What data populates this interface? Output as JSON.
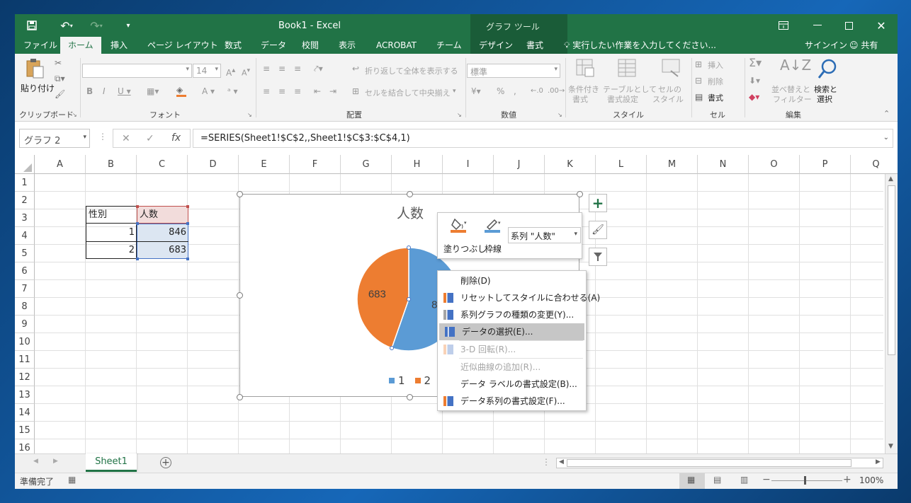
{
  "window": {
    "title": "Book1 - Excel",
    "chart_tools_label": "グラフ ツール"
  },
  "tabs": [
    "ファイル",
    "ホーム",
    "挿入",
    "ページ レイアウト",
    "数式",
    "データ",
    "校閲",
    "表示",
    "ACROBAT",
    "チーム",
    "デザイン",
    "書式"
  ],
  "tell_me": "実行したい作業を入力してください...",
  "signin": "サインイン",
  "share": "共有",
  "ribbon": {
    "clipboard": {
      "paste": "貼り付け",
      "label": "クリップボード"
    },
    "font": {
      "label": "フォント",
      "size": "14"
    },
    "alignment": {
      "wrap": "折り返して全体を表示する",
      "merge": "セルを結合して中央揃え",
      "label": "配置"
    },
    "number": {
      "format": "標準",
      "label": "数値"
    },
    "styles": {
      "conditional_1": "条件付き",
      "conditional_2": "書式",
      "table_1": "テーブルとして",
      "table_2": "書式設定",
      "cell_1": "セルの",
      "cell_2": "スタイル",
      "label": "スタイル"
    },
    "cells": {
      "insert": "挿入",
      "delete": "削除",
      "format": "書式",
      "label": "セル"
    },
    "editing": {
      "sort_1": "並べ替えと",
      "sort_2": "フィルター",
      "find_1": "検索と",
      "find_2": "選択",
      "label": "編集"
    }
  },
  "formula_bar": {
    "name_box": "グラフ 2",
    "formula": "=SERIES(Sheet1!$C$2,,Sheet1!$C$3:$C$4,1)"
  },
  "columns": [
    "A",
    "B",
    "C",
    "D",
    "E",
    "F",
    "G",
    "H",
    "I",
    "J",
    "K",
    "L",
    "M",
    "N",
    "O",
    "P",
    "Q"
  ],
  "rows": [
    "1",
    "2",
    "3",
    "4",
    "5",
    "6",
    "7",
    "8",
    "9",
    "10",
    "11",
    "12",
    "13",
    "14",
    "15",
    "16"
  ],
  "cells": {
    "b2": "性別",
    "c2": "人数",
    "b3": "1",
    "c3": "846",
    "b4": "2",
    "c4": "683"
  },
  "chart_data": {
    "type": "pie",
    "title": "人数",
    "categories": [
      "1",
      "2"
    ],
    "values": [
      846,
      683
    ],
    "data_labels": [
      "846",
      "683"
    ],
    "colors": [
      "#5b9bd5",
      "#ed7d31"
    ],
    "legend": "bottom"
  },
  "mini_toolbar": {
    "fill": "塗りつぶし",
    "outline": "枠線",
    "series": "系列 \"人数\""
  },
  "context_menu": [
    {
      "label": "削除(D)",
      "disabled": false
    },
    {
      "label": "リセットしてスタイルに合わせる(A)",
      "disabled": false
    },
    {
      "label": "系列グラフの種類の変更(Y)...",
      "disabled": false
    },
    {
      "label": "データの選択(E)...",
      "disabled": false,
      "highlighted": true
    },
    {
      "label": "3-D 回転(R)...",
      "disabled": true
    },
    {
      "label": "近似曲線の追加(R)...",
      "disabled": true
    },
    {
      "label": "データ ラベルの書式設定(B)...",
      "disabled": false
    },
    {
      "label": "データ系列の書式設定(F)...",
      "disabled": false
    }
  ],
  "sheet_tab": "Sheet1",
  "status": {
    "ready": "準備完了",
    "zoom": "100%"
  },
  "colors": {
    "excel_green": "#217346",
    "selection_blue": "#dce6f2",
    "header_red": "#c0504d"
  }
}
